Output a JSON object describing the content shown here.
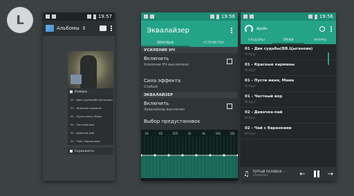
{
  "user": {
    "initial": "L"
  },
  "gallery": {
    "time": "19:57",
    "title": "Альбомы",
    "albums": [
      {
        "label": "Камера"
      },
      {
        "label": "Скриншоты"
      }
    ],
    "playlist": [
      "01 - Две судьбы(ВВ.Цыганова)",
      "01 - Красные карманы",
      "01 - Пусти меня, Мама",
      "01 - Честный вор",
      "02 - Девочка-пай",
      "02 - Чай с баранками"
    ]
  },
  "equalizer": {
    "time": "19:58",
    "title": "Эквалайзер",
    "tabs": [
      "ЗВУКОВЫЕ",
      "УСТРОЙСТВА"
    ],
    "section_amp": "УСИЛЕНИЕ НЧ",
    "bass_enable": {
      "title": "Включить",
      "summary": "Усиление НЧ выключено"
    },
    "bass_strength": {
      "title": "Сила эффекта",
      "summary": "Слабый"
    },
    "section_eq": "ЭКВАЛАЙЗЕР",
    "eq_enable": {
      "title": "Включить",
      "summary": "Эквалайзер выключен"
    },
    "preset": "Выбор предустановок",
    "bands": [
      "16",
      "62",
      "250",
      "1k",
      "4k",
      "16k",
      "32k"
    ],
    "band_values": [
      0.55,
      0.55,
      0.55,
      0.55,
      0.55,
      0.55,
      0.55,
      0.55
    ]
  },
  "player": {
    "time": "19:56",
    "title": "Apollo",
    "tabs": [
      "АЛЬБОМЫ",
      "ТРЕКИ",
      "ЖАНРЫ"
    ],
    "tracks": [
      {
        "title": "01 - Две судьбы(ВВ.Цыганова)",
        "artist": "М.Круг"
      },
      {
        "title": "01 - Красные карманы",
        "artist": "М.Круг"
      },
      {
        "title": "01 - Пусти меня, Мама",
        "artist": "М.Круг"
      },
      {
        "title": "01 - Честный вор",
        "artist": "М.Круг"
      },
      {
        "title": "02 - Девочка-пай",
        "artist": "М.Круг"
      },
      {
        "title": "02 - Чай с баранками",
        "artist": "М.Круг"
      }
    ],
    "now_playing": {
      "title": "ТЕРТЫЙ ПАЛИВОК -...",
      "artist": "«Альбом»"
    }
  },
  "colors": {
    "accent": "#25a387",
    "background": "#3c4144"
  }
}
